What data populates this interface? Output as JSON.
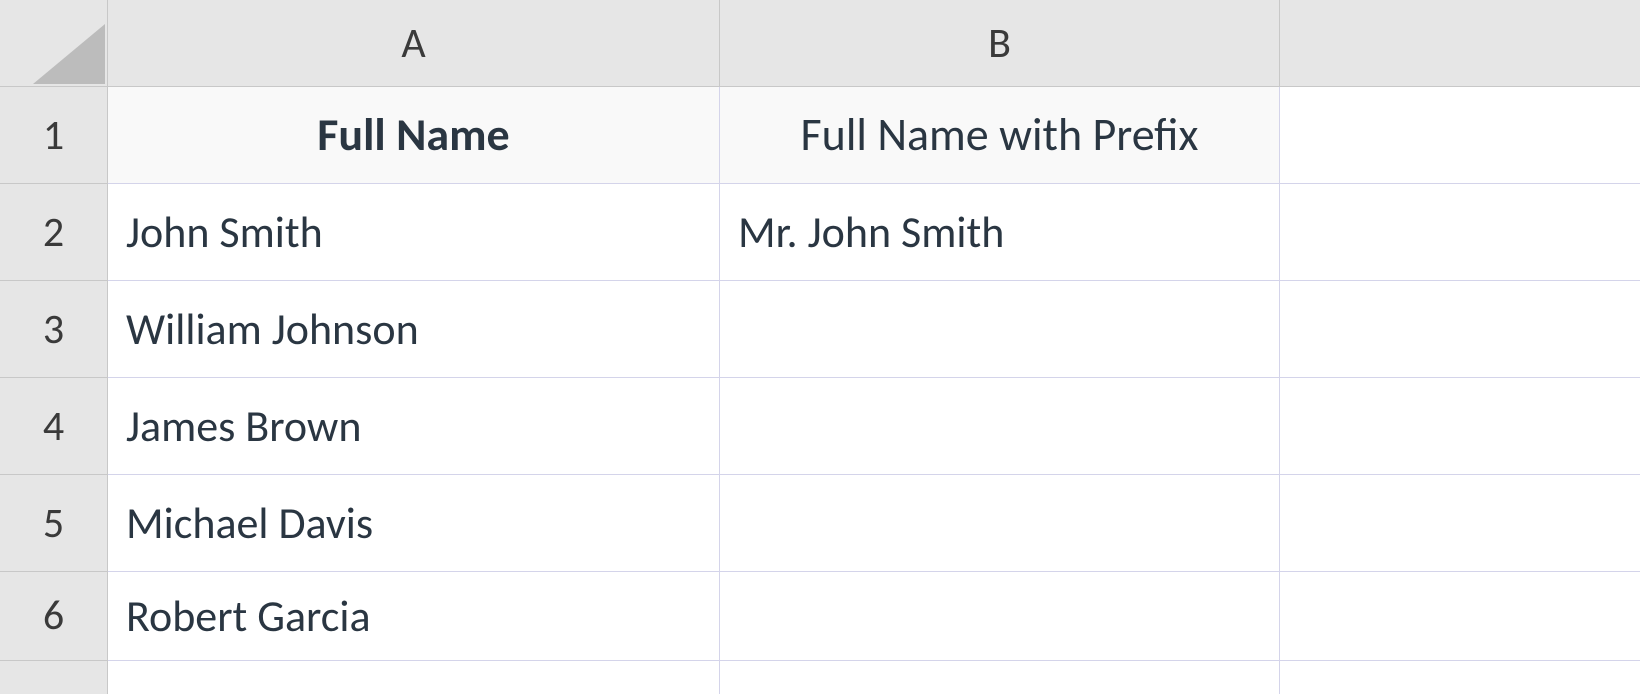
{
  "columns": [
    "A",
    "B"
  ],
  "rowNumbers": [
    "1",
    "2",
    "3",
    "4",
    "5",
    "6"
  ],
  "headers": {
    "A": "Full Name",
    "B": "Full Name with Prefix"
  },
  "rows": [
    {
      "A": "John Smith",
      "B": "Mr. John Smith"
    },
    {
      "A": "William Johnson",
      "B": ""
    },
    {
      "A": "James Brown",
      "B": ""
    },
    {
      "A": "Michael Davis",
      "B": ""
    },
    {
      "A": "Robert Garcia",
      "B": ""
    }
  ]
}
